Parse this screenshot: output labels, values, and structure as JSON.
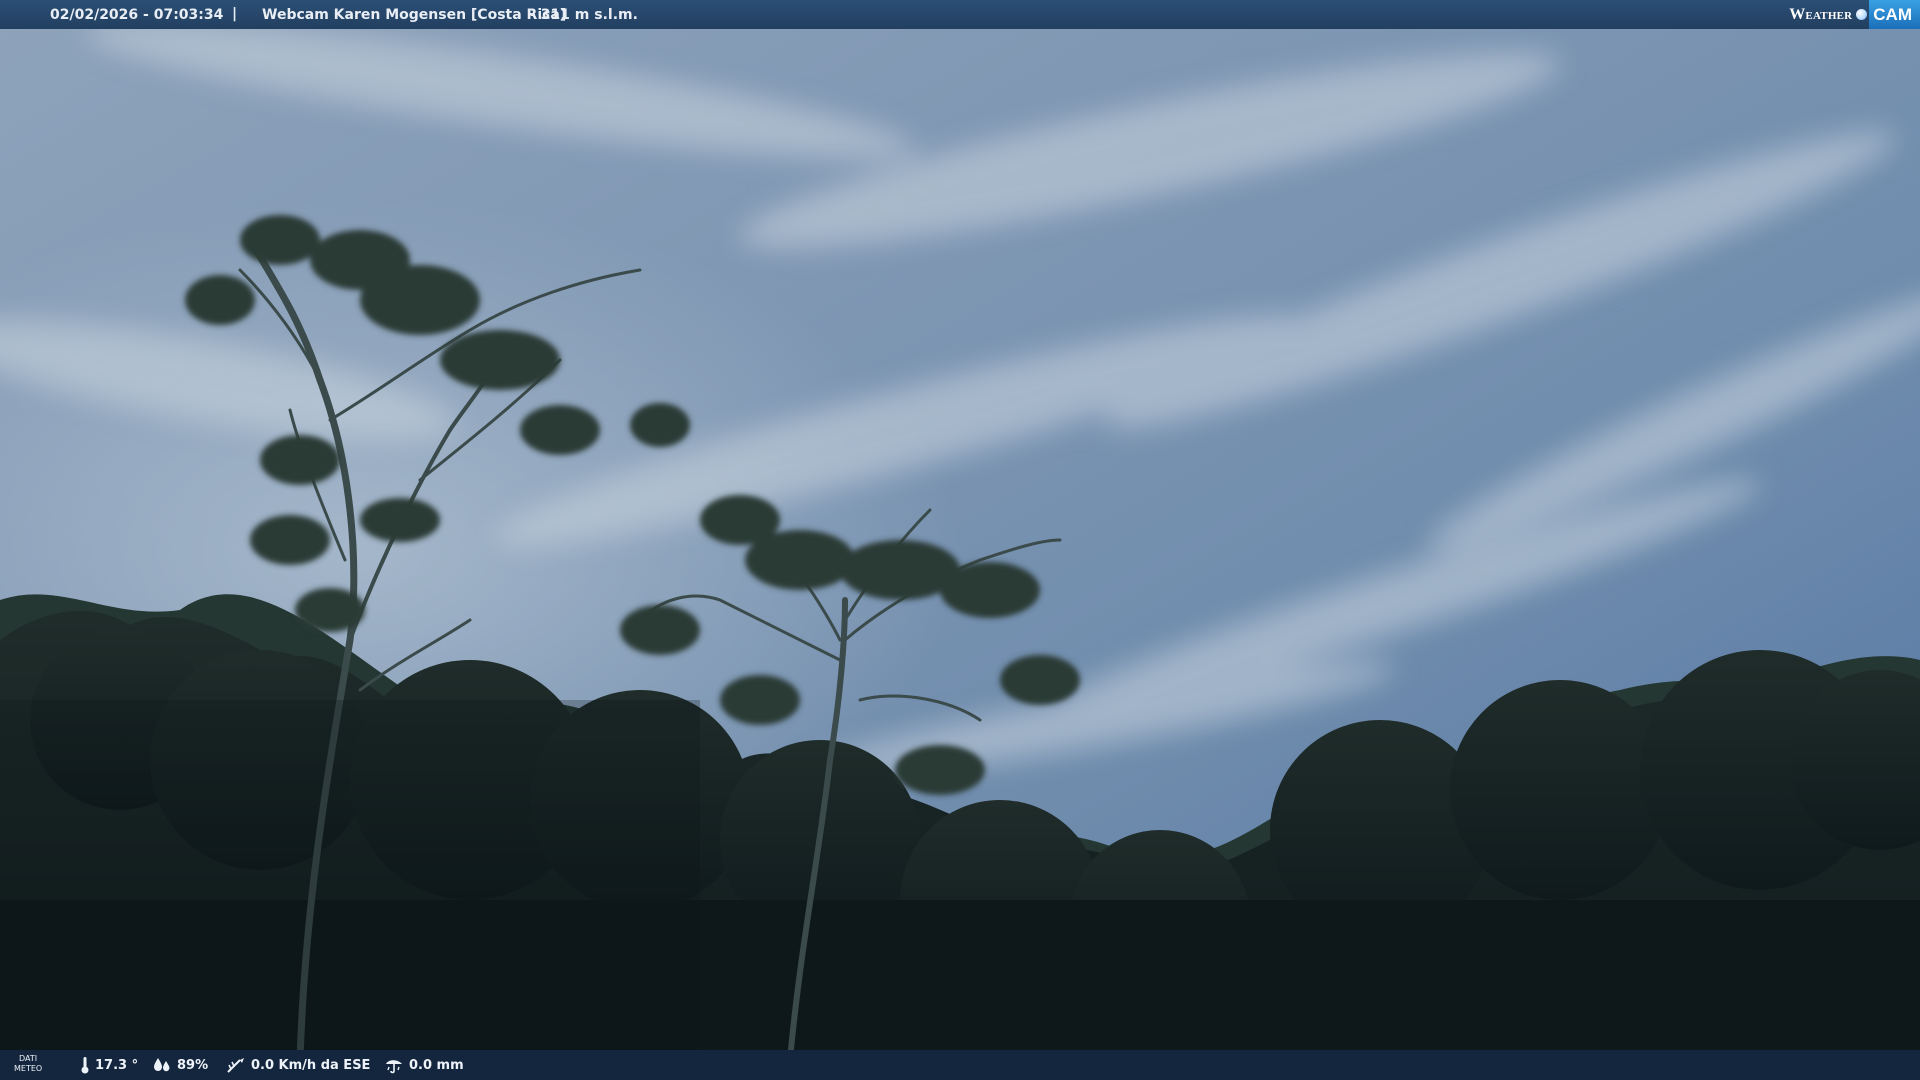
{
  "header": {
    "timestamp": "02/02/2026 - 07:03:34",
    "separator": "|",
    "title": "Webcam Karen Mogensen [Costa Rica]",
    "altitude": "- 311 m s.l.m.",
    "logo_word": "Weather",
    "logo_cam": "CAM"
  },
  "weather": {
    "section_label_line1": "DATI",
    "section_label_line2": "METEO",
    "temperature": "17.3 °",
    "humidity": "89%",
    "wind": "0.0 Km/h da ESE",
    "rain": "0.0 mm",
    "icons": [
      "thermometer-icon",
      "humidity-icon",
      "wind-icon",
      "rain-icon"
    ]
  },
  "colors": {
    "topbar": "#2b4f75",
    "bottombar": "#13263d",
    "logo_accent": "#3aa0e4"
  }
}
